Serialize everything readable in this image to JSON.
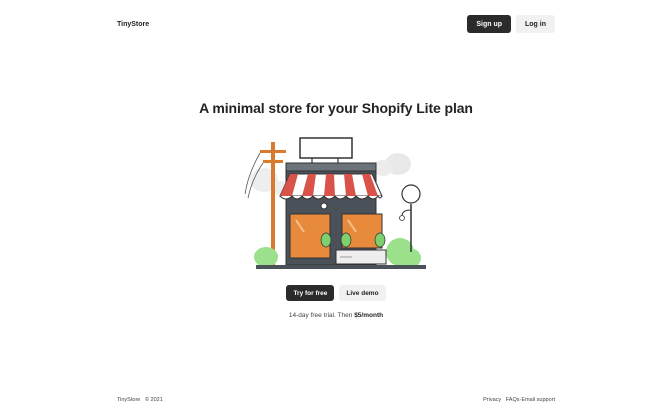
{
  "header": {
    "brand": "TinyStore",
    "signup_label": "Sign up",
    "login_label": "Log in"
  },
  "hero": {
    "title": "A minimal store for your Shopify Lite plan",
    "primary_cta": "Try for free",
    "secondary_cta": "Live demo",
    "trial_prefix": "14-day free trial. Then ",
    "trial_price": "$5/month"
  },
  "footer": {
    "brand": "TinyStore",
    "copyright": "© 2021",
    "links": [
      "Privacy",
      "FAQs",
      "Email support"
    ],
    "separator": "·"
  },
  "colors": {
    "dark_button": "#2b2b2b",
    "light_button": "#f1f1f1",
    "awning_red": "#d9534a",
    "window_orange": "#e88a3c",
    "plant_green": "#7ed06d"
  }
}
